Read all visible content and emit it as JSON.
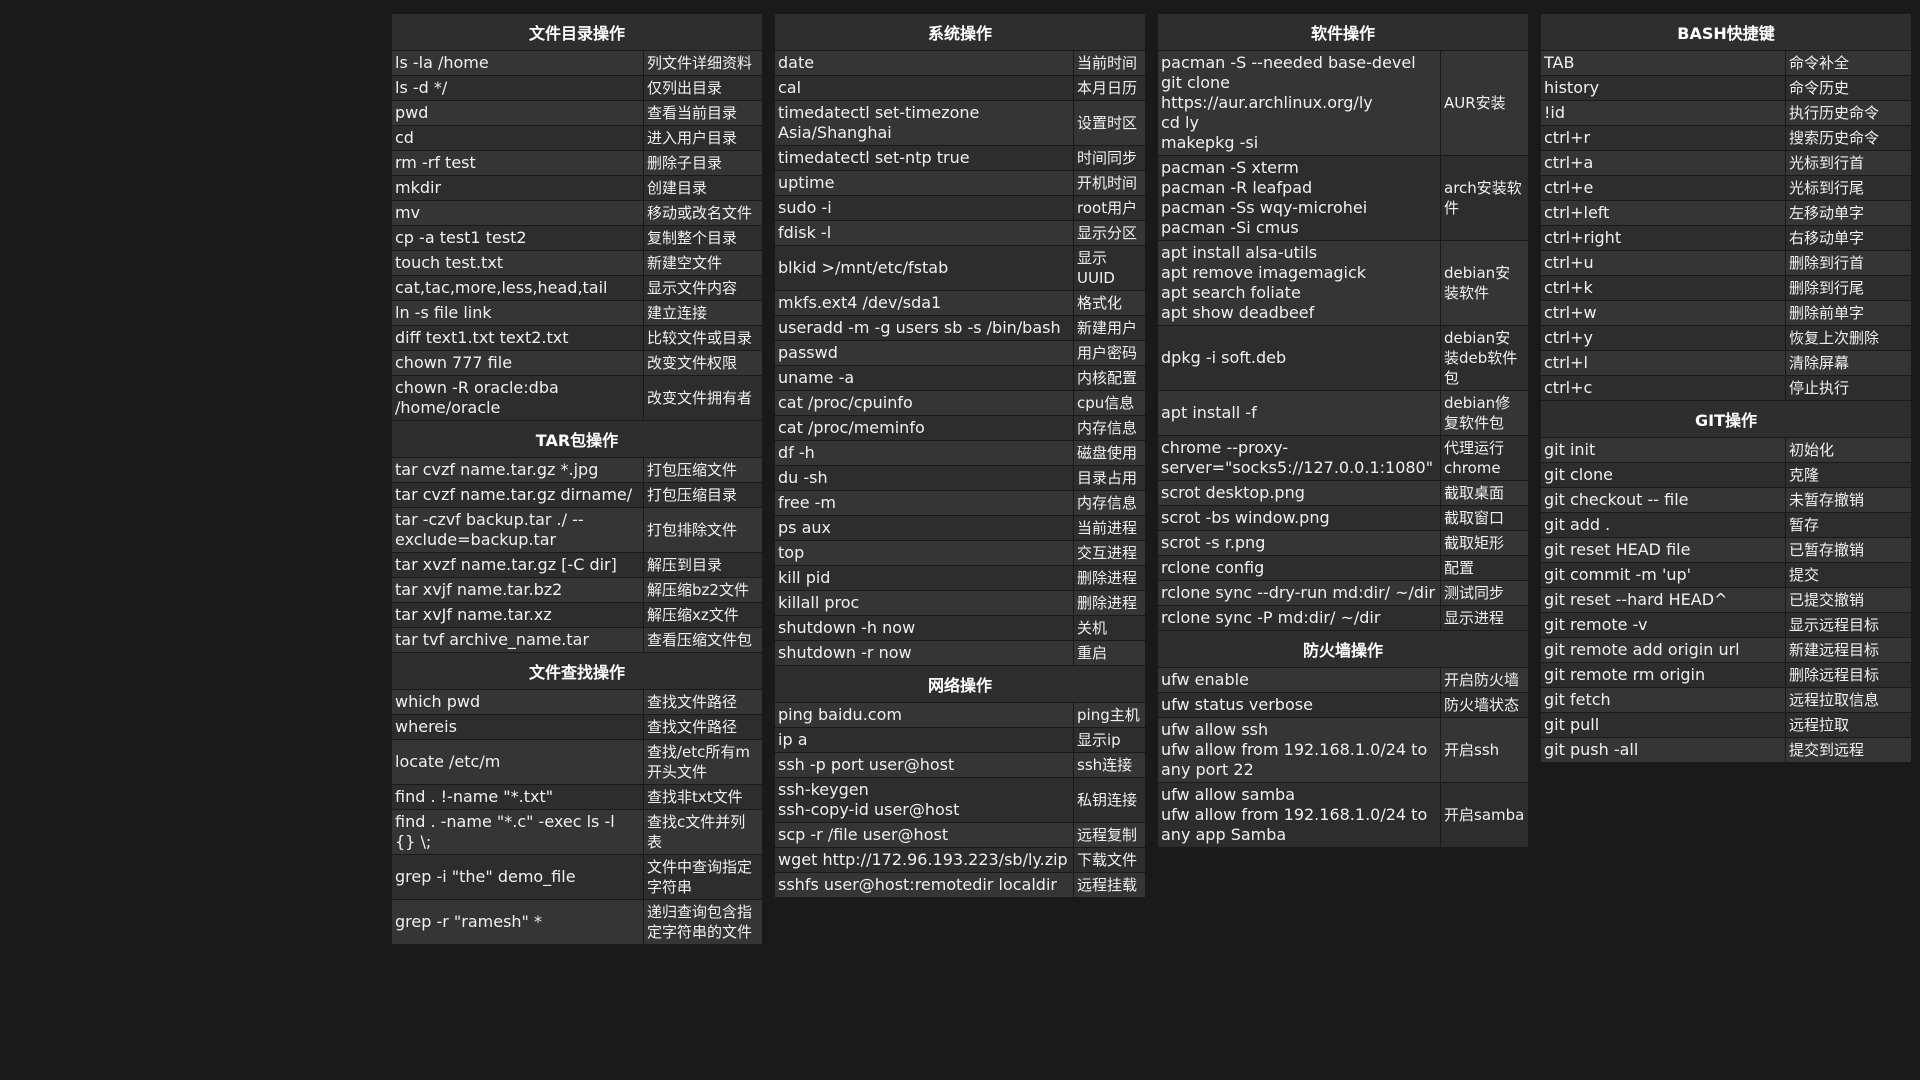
{
  "columns": [
    {
      "sections": [
        {
          "title": "文件目录操作",
          "rows": [
            [
              "ls -la /home",
              "列文件详细资料"
            ],
            [
              "ls -d */",
              "仅列出目录"
            ],
            [
              "pwd",
              "查看当前目录"
            ],
            [
              "cd",
              "进入用户目录"
            ],
            [
              "rm -rf test",
              "删除子目录"
            ],
            [
              "mkdir",
              "创建目录"
            ],
            [
              "mv",
              "移动或改名文件"
            ],
            [
              "cp -a test1 test2",
              "复制整个目录"
            ],
            [
              "touch test.txt",
              "新建空文件"
            ],
            [
              "cat,tac,more,less,head,tail",
              "显示文件内容"
            ],
            [
              "ln -s file link",
              "建立连接"
            ],
            [
              "diff text1.txt text2.txt",
              "比较文件或目录"
            ],
            [
              "chown 777 file",
              "改变文件权限"
            ],
            [
              "chown -R oracle:dba\n/home/oracle",
              "改变文件拥有者"
            ]
          ]
        },
        {
          "title": "TAR包操作",
          "rows": [
            [
              "tar cvzf name.tar.gz *.jpg",
              "打包压缩文件"
            ],
            [
              "tar cvzf name.tar.gz dirname/",
              "打包压缩目录"
            ],
            [
              "tar -czvf backup.tar ./ --\nexclude=backup.tar",
              "打包排除文件"
            ],
            [
              "tar xvzf name.tar.gz [-C dir]",
              "解压到目录"
            ],
            [
              "tar xvjf name.tar.bz2",
              "解压缩bz2文件"
            ],
            [
              "tar xvJf name.tar.xz",
              "解压缩xz文件"
            ],
            [
              "tar tvf archive_name.tar",
              "查看压缩文件包"
            ]
          ]
        },
        {
          "title": "文件查找操作",
          "rows": [
            [
              "which pwd",
              "查找文件路径"
            ],
            [
              "whereis",
              "查找文件路径"
            ],
            [
              "locate /etc/m",
              "查找/etc所有m\n开头文件"
            ],
            [
              "find . !-name \"*.txt\"",
              "查找非txt文件"
            ],
            [
              "find . -name \"*.c\" -exec ls -l {} \\;",
              "查找c文件并列\n表"
            ],
            [
              "grep -i \"the\" demo_file",
              "文件中查询指定\n字符串"
            ],
            [
              "grep -r \"ramesh\" *",
              "递归查询包含指\n定字符串的文件"
            ]
          ]
        }
      ]
    },
    {
      "sections": [
        {
          "title": "系统操作",
          "rows": [
            [
              "date",
              "当前时间"
            ],
            [
              "cal",
              "本月日历"
            ],
            [
              "timedatectl set-timezone\nAsia/Shanghai",
              "设置时区"
            ],
            [
              "timedatectl set-ntp true",
              "时间同步"
            ],
            [
              "uptime",
              "开机时间"
            ],
            [
              "sudo -i",
              "root用户"
            ],
            [
              "fdisk -l",
              "显示分区"
            ],
            [
              "blkid >/mnt/etc/fstab",
              "显示\nUUID"
            ],
            [
              "mkfs.ext4 /dev/sda1",
              "格式化"
            ],
            [
              "useradd -m -g users sb -s /bin/bash",
              "新建用户"
            ],
            [
              "passwd",
              "用户密码"
            ],
            [
              "uname -a",
              "内核配置"
            ],
            [
              "cat /proc/cpuinfo",
              "cpu信息"
            ],
            [
              "cat /proc/meminfo",
              "内存信息"
            ],
            [
              "df -h",
              "磁盘使用"
            ],
            [
              "du -sh",
              "目录占用"
            ],
            [
              "free -m",
              "内存信息"
            ],
            [
              "ps aux",
              "当前进程"
            ],
            [
              "top",
              "交互进程"
            ],
            [
              "kill pid",
              "删除进程"
            ],
            [
              "killall proc",
              "删除进程"
            ],
            [
              "shutdown -h now",
              "关机"
            ],
            [
              "shutdown -r now",
              "重启"
            ]
          ]
        },
        {
          "title": "网络操作",
          "rows": [
            [
              "ping baidu.com",
              "ping主机"
            ],
            [
              "ip a",
              "显示ip"
            ],
            [
              "ssh -p port user@host",
              "ssh连接"
            ],
            [
              "ssh-keygen\nssh-copy-id user@host",
              "私钥连接"
            ],
            [
              "scp -r /file user@host",
              "远程复制"
            ],
            [
              "wget http://172.96.193.223/sb/ly.zip",
              "下载文件"
            ],
            [
              "sshfs user@host:remotedir localdir",
              "远程挂载"
            ]
          ]
        }
      ]
    },
    {
      "sections": [
        {
          "title": "软件操作",
          "rows": [
            [
              "pacman -S --needed base-devel\ngit clone https://aur.archlinux.org/ly\ncd ly\nmakepkg -si",
              "AUR安装"
            ],
            [
              "pacman -S xterm\npacman -R leafpad\npacman -Ss wqy-microhei\npacman -Si cmus",
              "arch安装软\n件"
            ],
            [
              "apt install alsa-utils\napt remove imagemagick\napt search foliate\napt show deadbeef",
              "debian安\n装软件"
            ],
            [
              "dpkg -i soft.deb",
              "debian安\n装deb软件\n包"
            ],
            [
              "apt install -f",
              "debian修\n复软件包"
            ],
            [
              "chrome --proxy-\nserver=\"socks5://127.0.0.1:1080\"",
              "代理运行\nchrome"
            ],
            [
              "scrot desktop.png",
              "截取桌面"
            ],
            [
              "scrot -bs window.png",
              "截取窗口"
            ],
            [
              "scrot -s r.png",
              "截取矩形"
            ],
            [
              "rclone config",
              "配置"
            ],
            [
              "rclone sync --dry-run md:dir/ ~/dir",
              "测试同步"
            ],
            [
              "rclone sync -P md:dir/ ~/dir",
              "显示进程"
            ]
          ]
        },
        {
          "title": "防火墙操作",
          "rows": [
            [
              "ufw enable",
              "开启防火墙"
            ],
            [
              "ufw status verbose",
              "防火墙状态"
            ],
            [
              "ufw allow ssh\nufw allow from 192.168.1.0/24 to\nany port 22",
              "开启ssh"
            ],
            [
              "ufw allow samba\nufw allow from 192.168.1.0/24 to\nany app Samba",
              "开启samba"
            ]
          ]
        }
      ]
    },
    {
      "sections": [
        {
          "title": "BASH快捷键",
          "rows": [
            [
              "TAB",
              "命令补全"
            ],
            [
              "history",
              "命令历史"
            ],
            [
              "!id",
              "执行历史命令"
            ],
            [
              "ctrl+r",
              "搜索历史命令"
            ],
            [
              "ctrl+a",
              "光标到行首"
            ],
            [
              "ctrl+e",
              "光标到行尾"
            ],
            [
              "ctrl+left",
              "左移动单字"
            ],
            [
              "ctrl+right",
              "右移动单字"
            ],
            [
              "ctrl+u",
              "删除到行首"
            ],
            [
              "ctrl+k",
              "删除到行尾"
            ],
            [
              "ctrl+w",
              "删除前单字"
            ],
            [
              "ctrl+y",
              "恢复上次删除"
            ],
            [
              "ctrl+l",
              "清除屏幕"
            ],
            [
              "ctrl+c",
              "停止执行"
            ]
          ]
        },
        {
          "title": "GIT操作",
          "rows": [
            [
              "git init",
              "初始化"
            ],
            [
              "git clone",
              "克隆"
            ],
            [
              "git checkout -- file",
              "未暂存撤销"
            ],
            [
              "git add .",
              "暂存"
            ],
            [
              "git reset HEAD file",
              "已暂存撤销"
            ],
            [
              "git commit -m 'up'",
              "提交"
            ],
            [
              "git reset --hard HEAD^",
              "已提交撤销"
            ],
            [
              "git remote -v",
              "显示远程目标"
            ],
            [
              "git remote add origin url",
              "新建远程目标"
            ],
            [
              "git remote rm origin",
              "删除远程目标"
            ],
            [
              "git fetch",
              "远程拉取信息"
            ],
            [
              "git pull",
              "远程拉取"
            ],
            [
              "git push -all",
              "提交到远程"
            ]
          ]
        }
      ]
    }
  ]
}
